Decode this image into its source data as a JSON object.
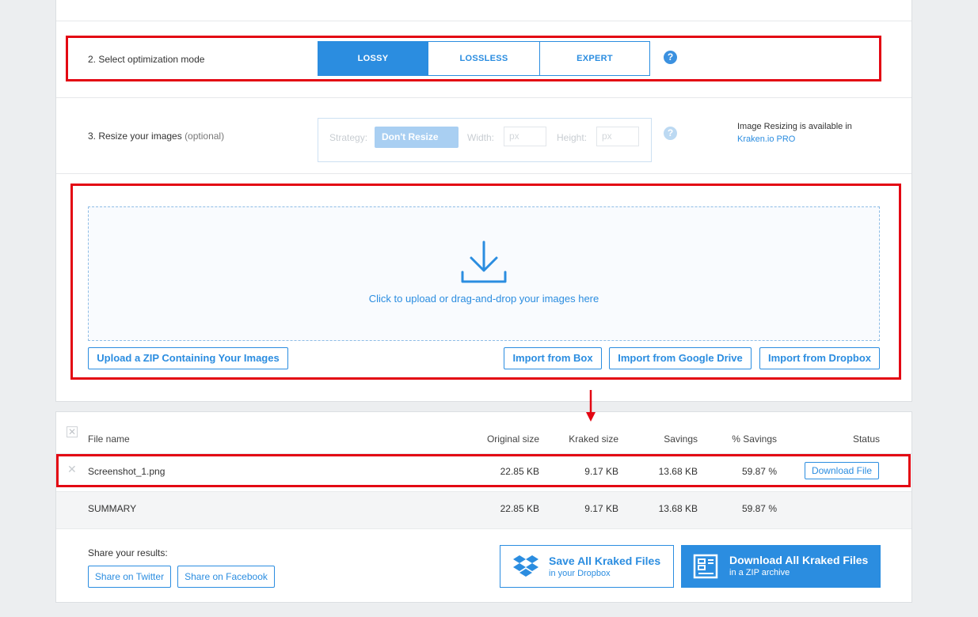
{
  "mode": {
    "label": "2. Select optimization mode",
    "options": [
      "LOSSY",
      "LOSSLESS",
      "EXPERT"
    ],
    "selected": "LOSSY",
    "help": "?"
  },
  "resize": {
    "label": "3. Resize your images",
    "optional": "(optional)",
    "strategy_label": "Strategy:",
    "strategy_value": "Don't Resize",
    "width_label": "Width:",
    "width_placeholder": "px",
    "height_label": "Height:",
    "height_placeholder": "px",
    "help": "?",
    "pro_note_bold": "Image Resizing",
    "pro_note_text": " is available in",
    "pro_link": "Kraken.io PRO"
  },
  "upload": {
    "drop_text": "Click to upload or drag-and-drop your images here",
    "zip_button": "Upload a ZIP Containing Your Images",
    "box_button": "Import from Box",
    "gdrive_button": "Import from Google Drive",
    "dropbox_button": "Import from Dropbox"
  },
  "table": {
    "headers": [
      "File name",
      "Original size",
      "Kraked size",
      "Savings",
      "% Savings",
      "Status"
    ],
    "rows": [
      {
        "file": "Screenshot_1.png",
        "original": "22.85 KB",
        "kraked": "9.17 KB",
        "savings": "13.68 KB",
        "percent": "59.87 %",
        "status_button": "Download File"
      }
    ],
    "summary": {
      "label": "SUMMARY",
      "original": "22.85 KB",
      "kraked": "9.17 KB",
      "savings": "13.68 KB",
      "percent": "59.87 %"
    }
  },
  "share": {
    "label": "Share your results:",
    "twitter": "Share on Twitter",
    "facebook": "Share on Facebook"
  },
  "actions": {
    "dropbox_main": "Save All Kraked Files",
    "dropbox_sub": "in your Dropbox",
    "zip_main": "Download All Kraked Files",
    "zip_sub": "in a ZIP archive"
  },
  "colors": {
    "accent": "#2b8de0",
    "highlight": "#e30613"
  }
}
